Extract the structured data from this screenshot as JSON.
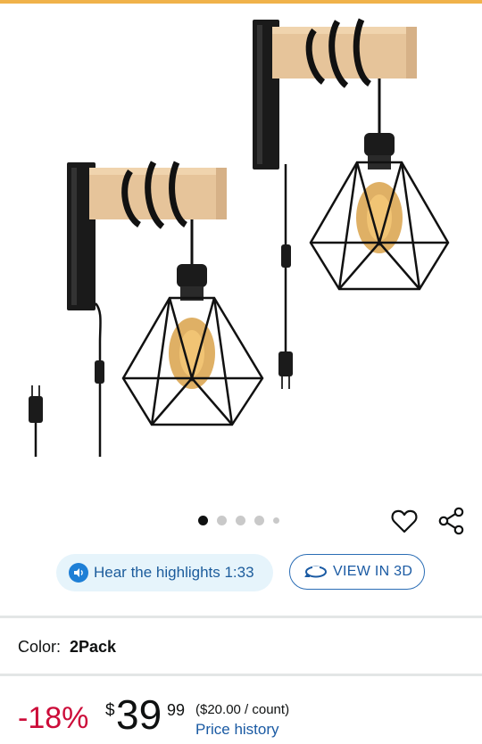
{
  "product": {
    "image_alt": "Two wooden wall sconces with black cage pendant lights",
    "carousel": {
      "active_index": 0,
      "count": 5
    }
  },
  "actions": {
    "favorite_icon": "heart-outline-icon",
    "share_icon": "share-icon"
  },
  "buttons": {
    "hear_highlights": "Hear the highlights 1:33",
    "view_3d": "VIEW IN 3D"
  },
  "variant": {
    "label": "Color:",
    "value": "2Pack"
  },
  "price": {
    "discount": "-18%",
    "currency": "$",
    "whole": "39",
    "fraction": "99",
    "unit_price": "($20.00 / count)",
    "history_link": "Price history"
  },
  "colors": {
    "discount_red": "#cc0c39",
    "link_blue": "#1a5aa3",
    "pill_bg": "#e6f4fb",
    "top_strip": "#f0b24a"
  }
}
